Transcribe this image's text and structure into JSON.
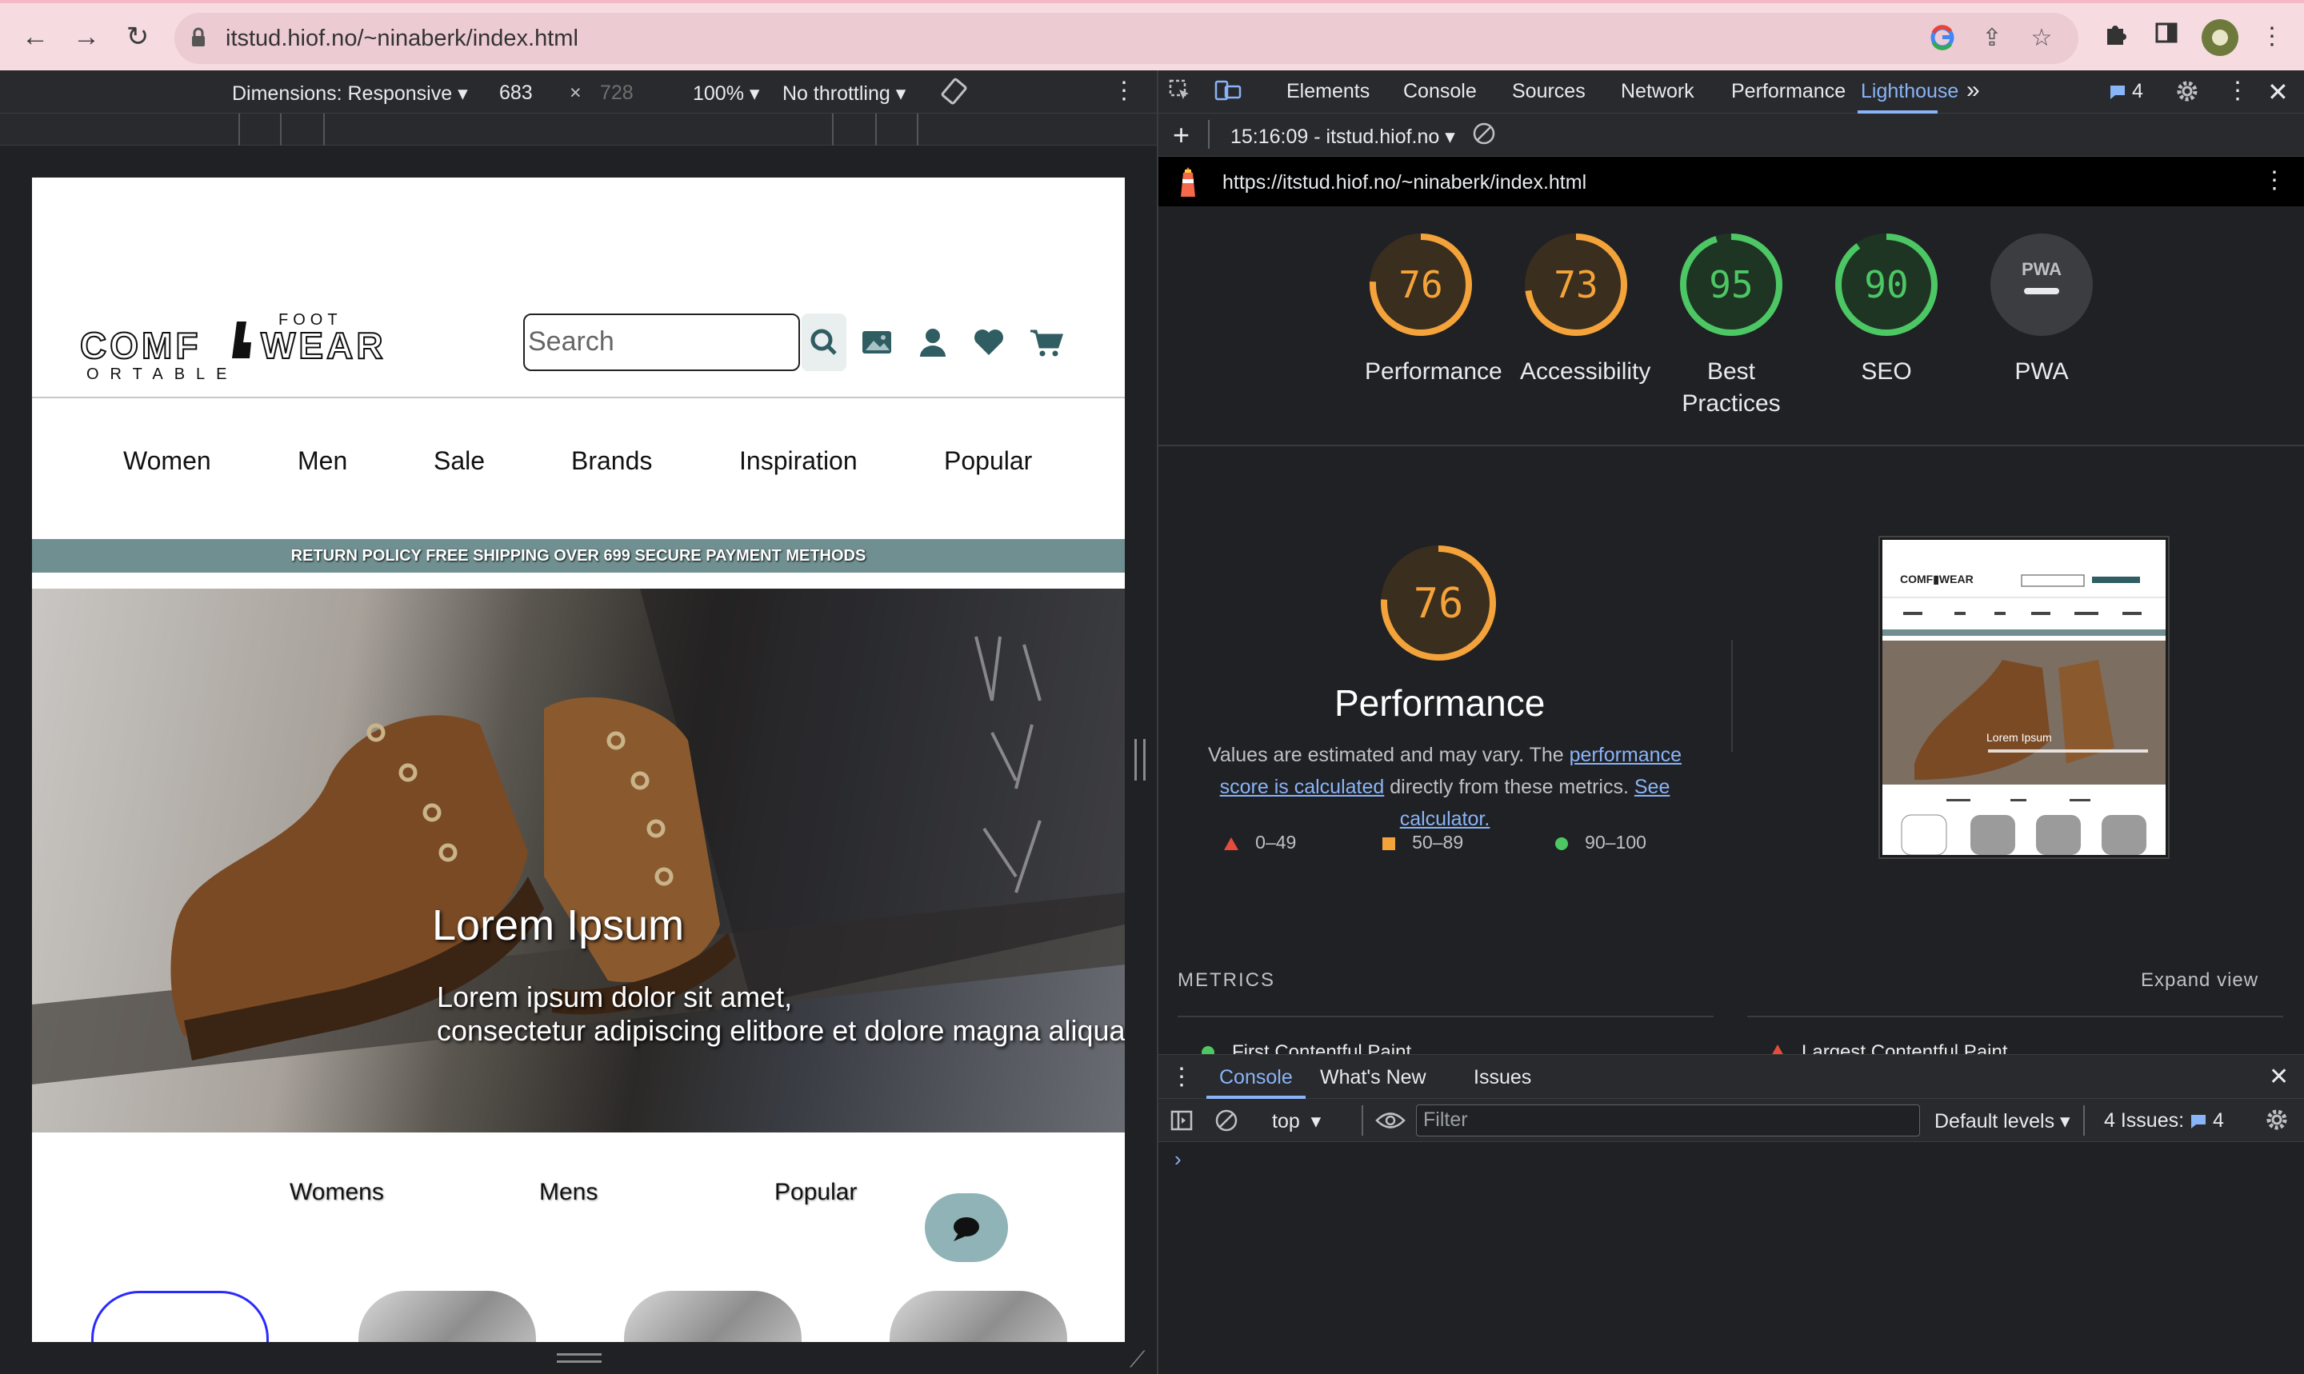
{
  "browser": {
    "url": "itstud.hiof.no/~ninaberk/index.html",
    "colors": {
      "chrome_bg": "#f6dbe1",
      "omnibox_bg": "#eccbd2"
    }
  },
  "device_toolbar": {
    "dimensions": "Dimensions: Responsive",
    "width": "683",
    "times": "×",
    "height": "728",
    "zoom": "100%",
    "throttling": "No throttling"
  },
  "devtools": {
    "tabs": [
      "Elements",
      "Console",
      "Sources",
      "Network",
      "Performance",
      "Lighthouse"
    ],
    "active_tab": "Lighthouse",
    "issues_count": "4",
    "report_time": "15:16:09 - itstud.hiof.no",
    "report_url": "https://itstud.hiof.no/~ninaberk/index.html"
  },
  "lighthouse": {
    "scores": [
      {
        "label": "Performance",
        "value": "76",
        "fraction": 0.76,
        "color": "#f4a33a"
      },
      {
        "label": "Accessibility",
        "value": "73",
        "fraction": 0.73,
        "color": "#f4a33a"
      },
      {
        "label": "Best Practices",
        "value": "95",
        "fraction": 0.95,
        "color": "#4cc764"
      },
      {
        "label": "SEO",
        "value": "90",
        "fraction": 0.9,
        "color": "#4cc764"
      },
      {
        "label": "PWA",
        "value": "PWA",
        "fraction": 0,
        "color": "#9aa0a6"
      }
    ],
    "perf_score": "76",
    "perf_title": "Performance",
    "perf_note_1": "Values are estimated and may vary. The ",
    "perf_note_link1": "performance score is calculated",
    "perf_note_2": " directly from these metrics. ",
    "perf_note_link2": "See calculator.",
    "legend": [
      {
        "range": "0–49",
        "color": "#e54c3c",
        "shape": "triangle"
      },
      {
        "range": "50–89",
        "color": "#f4a33a",
        "shape": "square"
      },
      {
        "range": "90–100",
        "color": "#4cc764",
        "shape": "circle"
      }
    ],
    "metrics_label": "METRICS",
    "expand_view": "Expand view",
    "metric_items": [
      "First Contentful Paint",
      "Largest Contentful Paint"
    ]
  },
  "console_drawer": {
    "tabs": [
      "Console",
      "What's New",
      "Issues"
    ],
    "context": "top",
    "filter_placeholder": "Filter",
    "levels": "Default levels",
    "issues_label": "4 Issues:",
    "issues_count": "4"
  },
  "site": {
    "logo_top": "FOOT",
    "logo_main_left": "COMF",
    "logo_main_right": "WEAR",
    "logo_bottom": "ORTABLE",
    "search_placeholder": "Search",
    "nav": [
      "Women",
      "Men",
      "Sale",
      "Brands",
      "Inspiration",
      "Popular"
    ],
    "promo": "RETURN POLICY FREE SHIPPING OVER 699 SECURE PAYMENT METHODS",
    "hero_title": "Lorem Ipsum",
    "hero_sub_1": "Lorem ipsum dolor sit amet,",
    "hero_sub_2": "consectetur adipiscing elitbore et dolore magna aliqua.",
    "categories": [
      "Womens",
      "Mens",
      "Popular"
    ],
    "colors": {
      "promo_bg": "#6f8f91",
      "chat_bg": "#8fb3b7",
      "icon": "#2f5d62"
    }
  }
}
